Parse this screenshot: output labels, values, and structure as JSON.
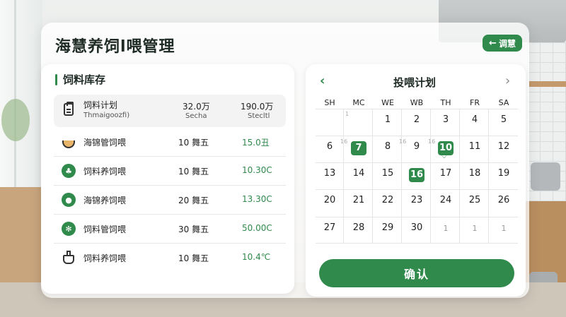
{
  "app": {
    "title": "海慧养饲l喂管理",
    "top_button": "调慧"
  },
  "inventory": {
    "title": "饲料库存",
    "header": {
      "name": "饲料计划",
      "sub": "Thmaigoozfi)",
      "v1": "32.0万",
      "v1_sub": "Secha",
      "v2": "190.0万",
      "v2_sub": "Stecltl"
    },
    "rows": [
      {
        "icon": "food-bowl-icon",
        "name": "海锦管饲喂",
        "qty": "10 舞五",
        "value": "15.0丑"
      },
      {
        "icon": "leaf-badge-icon",
        "name": "饲料养饲喂",
        "qty": "10 舞五",
        "value": "10.30C"
      },
      {
        "icon": "location-pin-icon",
        "name": "海锦养饲喂",
        "qty": "20 舞五",
        "value": "13.30C"
      },
      {
        "icon": "gear-badge-icon",
        "name": "饲料管饲喂",
        "qty": "30 舞五",
        "value": "50.00C"
      },
      {
        "icon": "flask-icon",
        "name": "饲料养饲喂",
        "qty": "10 舞五",
        "value": "10.4℃"
      }
    ]
  },
  "calendar": {
    "title": "投喂计划",
    "weekdays": [
      "SH",
      "MC",
      "WE",
      "WB",
      "TH",
      "FR",
      "SA"
    ],
    "weeks": [
      [
        "",
        "",
        "1",
        "2",
        "3",
        "4",
        "5"
      ],
      [
        "6",
        "7",
        "8",
        "9",
        "10",
        "11",
        "12"
      ],
      [
        "13",
        "14",
        "15",
        "16",
        "17",
        "18",
        "19"
      ],
      [
        "20",
        "21",
        "22",
        "23",
        "24",
        "25",
        "26"
      ],
      [
        "27",
        "28",
        "29",
        "30",
        "1",
        "1",
        "1"
      ]
    ],
    "mini_labels": {
      "w1c1": "1",
      "w2c1": "16",
      "w2c4": "16",
      "w2c5": "16"
    },
    "selected": [
      "7",
      "10",
      "16"
    ],
    "confirm_label": "确认",
    "accent": "#2f8a4c"
  }
}
